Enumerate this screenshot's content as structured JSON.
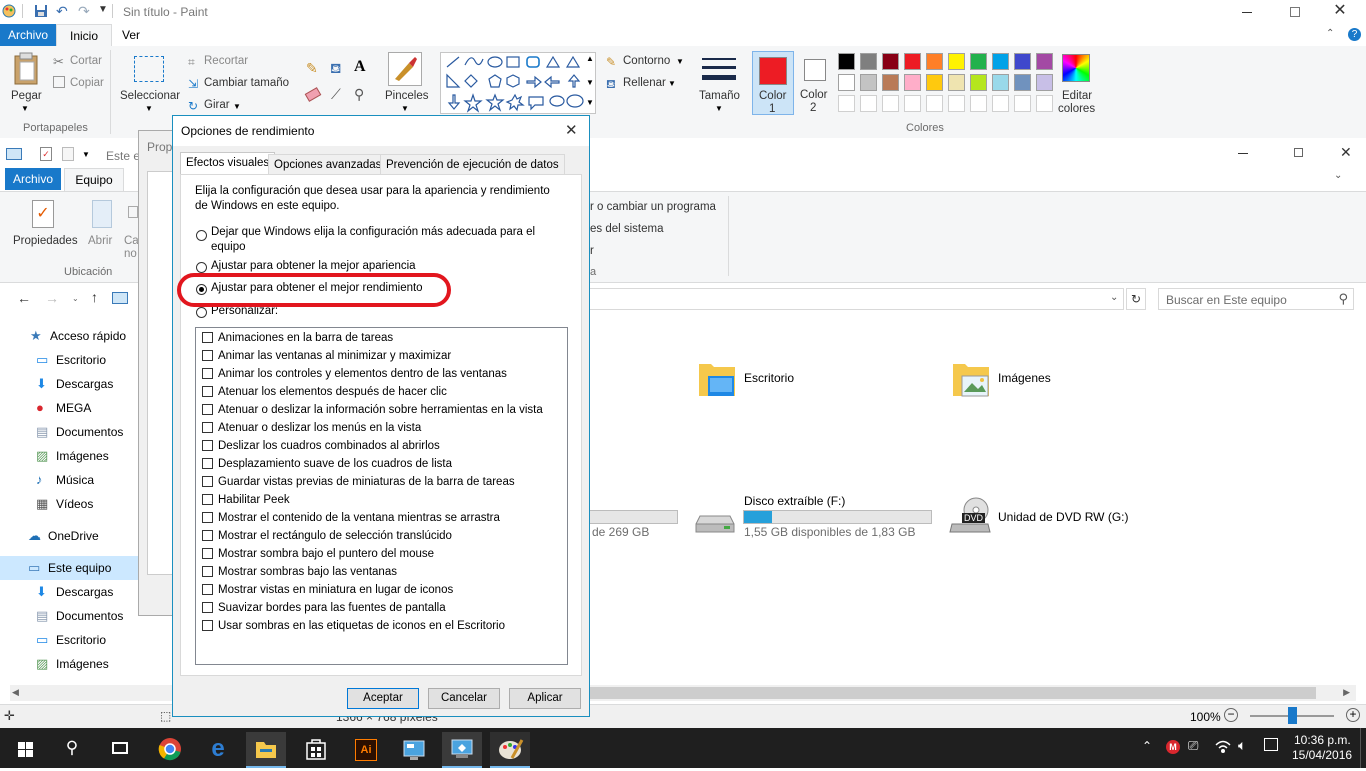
{
  "paint": {
    "title": "Sin título - Paint",
    "menu": {
      "file": "Archivo",
      "home": "Inicio",
      "view": "Ver"
    },
    "clipboard": {
      "paste": "Pegar",
      "cut": "Cortar",
      "copy": "Copiar",
      "group": "Portapapeles"
    },
    "image": {
      "select": "Seleccionar",
      "crop": "Recortar",
      "resize": "Cambiar tamaño",
      "rotate": "Girar"
    },
    "brushes": "Pinceles",
    "outline": "Contorno",
    "fill": "Rellenar",
    "size": "Tamaño",
    "color1": "Color\n1",
    "color1_a": "Color",
    "color1_b": "1",
    "color2_a": "Color",
    "color2_b": "2",
    "colors_group": "Colores",
    "edit_colors_a": "Editar",
    "edit_colors_b": "colores",
    "palette_row1": [
      "#000000",
      "#7f7f7f",
      "#880015",
      "#ed1c24",
      "#ff7f27",
      "#fff200",
      "#22b14c",
      "#00a2e8",
      "#3f48cc",
      "#a349a4"
    ],
    "palette_row2": [
      "#ffffff",
      "#c3c3c3",
      "#b97a57",
      "#ffaec9",
      "#ffc90e",
      "#efe4b0",
      "#b5e61d",
      "#99d9ea",
      "#7092be",
      "#c8bfe7"
    ],
    "status_dims": "1366 × 768 píxeles",
    "zoom": "100%"
  },
  "explorer": {
    "menu": {
      "file": "Archivo",
      "computer": "Equipo"
    },
    "address_fragment": "Este e",
    "ribbon": {
      "properties": "Propiedades",
      "open": "Abrir",
      "ca": "Ca",
      "no": "no",
      "location": "Ubicación",
      "change_program": "r o cambiar un programa",
      "system": "es del sistema",
      "r": "r",
      "a": "a"
    },
    "search_placeholder": "Buscar en Este equipo",
    "nav": [
      {
        "label": "Acceso rápido",
        "icon": "star-icon"
      },
      {
        "label": "Escritorio",
        "icon": "desktop-folder-icon"
      },
      {
        "label": "Descargas",
        "icon": "download-icon"
      },
      {
        "label": "MEGA",
        "icon": "mega-icon"
      },
      {
        "label": "Documentos",
        "icon": "document-icon"
      },
      {
        "label": "Imágenes",
        "icon": "pictures-icon"
      },
      {
        "label": "Música",
        "icon": "music-icon"
      },
      {
        "label": "Vídeos",
        "icon": "video-icon"
      },
      {
        "label": "OneDrive",
        "icon": "cloud-icon"
      },
      {
        "label": "Este equipo",
        "icon": "computer-icon"
      },
      {
        "label": "Descargas",
        "icon": "download-icon"
      },
      {
        "label": "Documentos",
        "icon": "document-icon"
      },
      {
        "label": "Escritorio",
        "icon": "desktop-folder-icon"
      },
      {
        "label": "Imágenes",
        "icon": "pictures-icon"
      }
    ],
    "folders": {
      "desktop": "Escritorio",
      "pictures": "Imágenes"
    },
    "drive_partial_space": "de 269 GB",
    "drive_f": {
      "name": "Disco extraíble (F:)",
      "space": "1,55 GB disponibles de 1,83 GB",
      "used_fraction": 0.15
    },
    "drive_g": {
      "name": "Unidad de DVD RW (G:)",
      "badge": "DVD"
    }
  },
  "behind_dialog": {
    "title_fragment": "Prop"
  },
  "dialog": {
    "title": "Opciones de rendimiento",
    "tabs": [
      "Efectos visuales",
      "Opciones avanzadas",
      "Prevención de ejecución de datos"
    ],
    "intro": "Elija la configuración que desea usar para la apariencia y rendimiento de Windows en este equipo.",
    "intro_line1": "Elija la configuración que desea usar para la apariencia y rendimiento",
    "intro_line2": "de Windows en este equipo.",
    "radio1_line1": "Dejar que Windows elija la configuración más adecuada para el",
    "radio1_line2": "equipo",
    "radio2": "Ajustar para obtener la mejor apariencia",
    "radio3": "Ajustar para obtener el mejor rendimiento",
    "radio4": "Personalizar:",
    "checkboxes": [
      "Animaciones en la barra de tareas",
      "Animar las ventanas al minimizar y maximizar",
      "Animar los controles y elementos dentro de las ventanas",
      "Atenuar los elementos después de hacer clic",
      "Atenuar o deslizar la información sobre herramientas en la vista",
      "Atenuar o deslizar los menús en la vista",
      "Deslizar los cuadros combinados al abrirlos",
      "Desplazamiento suave de los cuadros de lista",
      "Guardar vistas previas de miniaturas de la barra de tareas",
      "Habilitar Peek",
      "Mostrar el contenido de la ventana mientras se arrastra",
      "Mostrar el rectángulo de selección translúcido",
      "Mostrar sombra bajo el puntero del mouse",
      "Mostrar sombras bajo las ventanas",
      "Mostrar vistas en miniatura en lugar de iconos",
      "Suavizar bordes para las fuentes de pantalla",
      "Usar sombras en las etiquetas de iconos en el Escritorio"
    ],
    "ok": "Aceptar",
    "cancel": "Cancelar",
    "apply": "Aplicar"
  },
  "taskbar": {
    "time": "10:36 p.m.",
    "date": "15/04/2016"
  }
}
